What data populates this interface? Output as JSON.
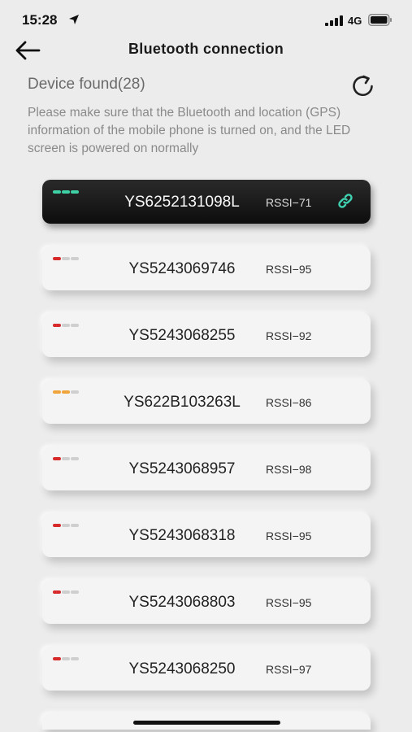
{
  "status_bar": {
    "time": "15:28",
    "network": "4G",
    "icons": [
      "location-arrow-icon",
      "signal-icon",
      "battery-icon"
    ]
  },
  "nav": {
    "title": "Bluetooth connection",
    "back_icon": "arrow-left-icon"
  },
  "device_section": {
    "title": "Device found(28)",
    "refresh_icon": "refresh-icon",
    "info": "Please make sure that the Bluetooth and location (GPS) information of the mobile phone is turned on, and the LED screen is powered on normally"
  },
  "colors": {
    "strong": "#3fd1a6",
    "medium": "#f0a43c",
    "weak": "#d62a2a",
    "inactive": "#cfcfcf",
    "link": "#3fd1b0"
  },
  "devices": [
    {
      "name": "YS6252131098L",
      "rssi": "RSSI−71",
      "connected": true,
      "level": 3
    },
    {
      "name": "YS5243069746",
      "rssi": "RSSI−95",
      "connected": false,
      "level": 1
    },
    {
      "name": "YS5243068255",
      "rssi": "RSSI−92",
      "connected": false,
      "level": 1
    },
    {
      "name": "YS622B103263L",
      "rssi": "RSSI−86",
      "connected": false,
      "level": 2
    },
    {
      "name": "YS5243068957",
      "rssi": "RSSI−98",
      "connected": false,
      "level": 1
    },
    {
      "name": "YS5243068318",
      "rssi": "RSSI−95",
      "connected": false,
      "level": 1
    },
    {
      "name": "YS5243068803",
      "rssi": "RSSI−95",
      "connected": false,
      "level": 1
    },
    {
      "name": "YS5243068250",
      "rssi": "RSSI−97",
      "connected": false,
      "level": 1
    }
  ]
}
